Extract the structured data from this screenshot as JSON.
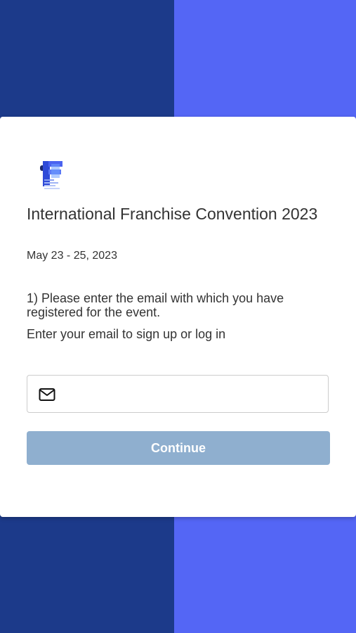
{
  "event": {
    "title": "International Franchise Convention 2023",
    "dates": "May 23 - 25, 2023",
    "logo_icon": "franchise-f-logo"
  },
  "form": {
    "instruction": "1) Please enter the email with which you have registered for the event.",
    "subinstruction": "Enter your email to sign up or log in",
    "email": {
      "icon": "mail-icon",
      "value": "",
      "placeholder": ""
    },
    "continue_label": "Continue"
  },
  "colors": {
    "bg_left": "#1c3a8a",
    "bg_right": "#5466f5",
    "button_disabled": "#8fafcf",
    "text": "#333333"
  }
}
